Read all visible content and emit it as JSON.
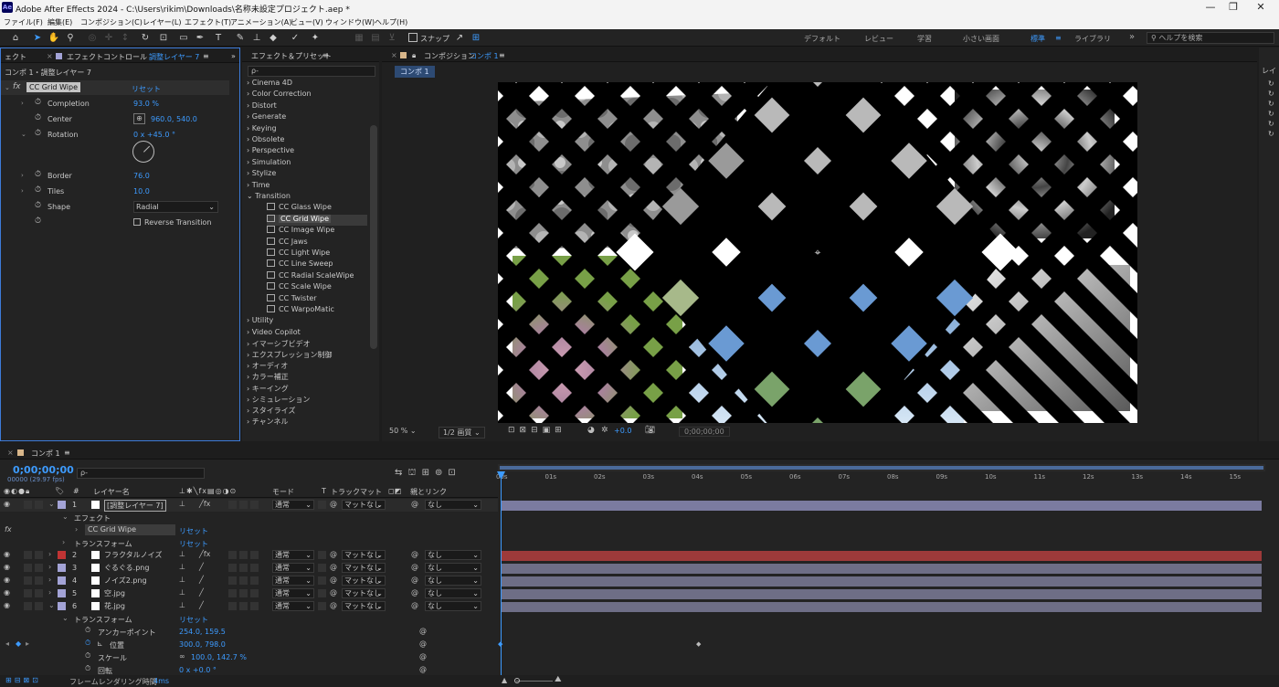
{
  "app": {
    "title": "Adobe After Effects 2024 - C:\\Users\\rikim\\Downloads\\名称未設定プロジェクト.aep *",
    "icon": "Ae"
  },
  "window_controls": {
    "minimize": "—",
    "maximize": "❐",
    "close": "✕"
  },
  "menu": [
    "ファイル(F)",
    "編集(E)",
    "コンポジション(C)",
    "レイヤー(L)",
    "エフェクト(T)",
    "アニメーション(A)",
    "ビュー(V)",
    "ウィンドウ(W)",
    "ヘルプ(H)"
  ],
  "toolbar": {
    "snap_label": "スナップ",
    "workspaces": [
      "デフォルト",
      "レビュー",
      "学習",
      "小さい画面",
      "標準",
      "ライブラリ"
    ],
    "active_workspace": "標準",
    "help_search_placeholder": "ヘルプを検索"
  },
  "effect_controls": {
    "tab_prefix": "エフェクトコントロール",
    "tab_layer": "調整レイヤー 7",
    "left_tab": "ェクト",
    "comp_path": "コンポ 1・調整レイヤー 7",
    "effect_name": "CC Grid Wipe",
    "reset": "リセット",
    "params": [
      {
        "name": "Completion",
        "value": "93.0 %"
      },
      {
        "name": "Center",
        "value": "960.0, 540.0"
      },
      {
        "name": "Rotation",
        "value": "0 x +45.0 °"
      },
      {
        "name": "Border",
        "value": "76.0"
      },
      {
        "name": "Tiles",
        "value": "10.0"
      },
      {
        "name": "Shape",
        "value": "Radial"
      },
      {
        "name": "",
        "value": "Reverse Transition"
      }
    ]
  },
  "effects_presets": {
    "tab": "エフェクト＆プリセット",
    "search_placeholder": "ρ-",
    "categories_top": [
      "Cinema 4D",
      "Color Correction",
      "Distort",
      "Generate",
      "Keying",
      "Obsolete",
      "Perspective",
      "Simulation",
      "Stylize",
      "Time",
      "Transition"
    ],
    "transition_items": [
      "CC Glass Wipe",
      "CC Grid Wipe",
      "CC Image Wipe",
      "CC Jaws",
      "CC Light Wipe",
      "CC Line Sweep",
      "CC Radial ScaleWipe",
      "CC Scale Wipe",
      "CC Twister",
      "CC WarpoMatic"
    ],
    "selected_item": "CC Grid Wipe",
    "categories_bottom": [
      "Utility",
      "Video Copilot",
      "イマーシブビデオ",
      "エクスプレッション制御",
      "オーディオ",
      "カラー補正",
      "キーイング",
      "シミュレーション",
      "スタイライズ",
      "チャンネル"
    ]
  },
  "composition": {
    "tab_prefix": "コンポジション",
    "tab_name": "コンポ 1",
    "sub_tab": "コンポ 1",
    "zoom": "50 %",
    "quality": "1/2 画質",
    "exposure": "+0.0",
    "timecode": "0;00;00;00"
  },
  "right_panel_label": "レイ",
  "timeline": {
    "tab": "コンポ 1",
    "timecode": "0;00;00;00",
    "frame_info": "00000 (29.97 fps)",
    "headers": {
      "layer_name": "レイヤー名",
      "mode": "モード",
      "t": "T",
      "track_matte": "トラックマット",
      "parent": "親とリンク"
    },
    "ruler": [
      "00s",
      "01s",
      "02s",
      "03s",
      "04s",
      "05s",
      "06s",
      "07s",
      "08s",
      "09s",
      "10s",
      "11s",
      "12s",
      "13s",
      "14s",
      "15s"
    ],
    "layers": [
      {
        "num": "1",
        "name": "[調整レイヤー 7]",
        "mode": "通常",
        "matte": "マットなし",
        "parent": "なし",
        "color": "#a3a3d6",
        "bar": "#7b7ba0"
      },
      {
        "num": "2",
        "name": "フラクタルノイズ",
        "mode": "通常",
        "matte": "マットなし",
        "parent": "なし",
        "color": "#c03434",
        "bar": "#9d3a3a"
      },
      {
        "num": "3",
        "name": "ぐるぐる.png",
        "mode": "通常",
        "matte": "マットなし",
        "parent": "なし",
        "color": "#a3a3d6",
        "bar": "#6e6e86"
      },
      {
        "num": "4",
        "name": "ノイズ2.png",
        "mode": "通常",
        "matte": "マットなし",
        "parent": "なし",
        "color": "#a3a3d6",
        "bar": "#6e6e86"
      },
      {
        "num": "5",
        "name": "空.jpg",
        "mode": "通常",
        "matte": "マットなし",
        "parent": "なし",
        "color": "#a3a3d6",
        "bar": "#6e6e86"
      },
      {
        "num": "6",
        "name": "花.jpg",
        "mode": "通常",
        "matte": "マットなし",
        "parent": "なし",
        "color": "#a3a3d6",
        "bar": "#6e6e86"
      }
    ],
    "effects_group": "エフェクト",
    "effect_entry": "CC Grid Wipe",
    "transform": "トランスフォーム",
    "reset": "リセット",
    "props": [
      {
        "name": "アンカーポイント",
        "value": "254.0, 159.5"
      },
      {
        "name": "位置",
        "value": "300.0, 798.0"
      },
      {
        "name": "スケール",
        "value": "100.0, 142.7 %"
      },
      {
        "name": "回転",
        "value": "0 x +0.0 °"
      }
    ],
    "render_time_label": "フレームレンダリング時間",
    "render_time": "4ms"
  },
  "colors": {
    "accent": "#3d9bff",
    "bg": "#1d1d1d",
    "panel": "#232323"
  }
}
